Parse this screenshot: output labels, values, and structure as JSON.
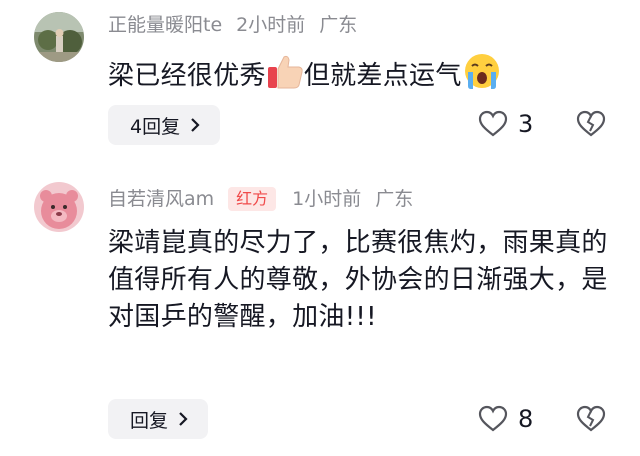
{
  "comments": [
    {
      "username": "正能量暖阳te",
      "time": "2小时前",
      "location": "广东",
      "badge": "",
      "text_main": "梁已经很优秀",
      "text_after": "但就差点运气",
      "emoji_1": "thumbs-up-icon",
      "emoji_2": "crying-face-icon",
      "reply_label": "4回复",
      "likes": "3"
    },
    {
      "username": "自若清风am",
      "time": "1小时前",
      "location": "广东",
      "badge": "红方",
      "text_main": "梁靖崑真的尽力了，比赛很焦灼，雨果真的值得所有人的尊敬，外协会的日渐强大，是对国乒的警醒，加油!!!",
      "reply_label": "回复",
      "likes": "8"
    }
  ]
}
